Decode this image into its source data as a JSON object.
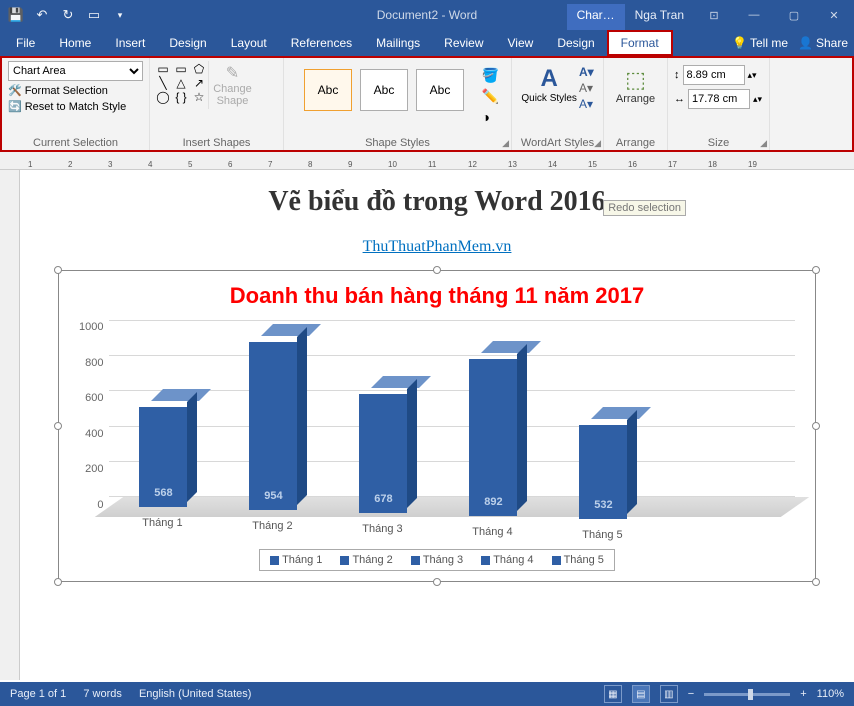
{
  "title": "Document2 - Word",
  "contextTab": "Char…",
  "user": "Nga Tran",
  "menu": [
    "File",
    "Home",
    "Insert",
    "Design",
    "Layout",
    "References",
    "Mailings",
    "Review",
    "View",
    "Design",
    "Format"
  ],
  "tellme": "Tell me",
  "share": "Share",
  "ribbon": {
    "selectionDropdown": "Chart Area",
    "formatSelection": "Format Selection",
    "resetMatch": "Reset to Match Style",
    "grpCurrent": "Current Selection",
    "changeShape": "Change Shape",
    "grpInsert": "Insert Shapes",
    "abc": "Abc",
    "grpStyles": "Shape Styles",
    "quickStyles": "Quick Styles",
    "grpWordArt": "WordArt Styles",
    "arrange": "Arrange",
    "grpArrange": "Arrange",
    "height": "8.89 cm",
    "width": "17.78 cm",
    "grpSize": "Size"
  },
  "tooltip": "Redo selection",
  "doc": {
    "heading": "Vẽ biểu đồ trong Word 2016",
    "link": "ThuThuatPhanMem.vn"
  },
  "chart_data": {
    "type": "bar",
    "title": "Doanh thu bán hàng tháng 11 năm 2017",
    "categories": [
      "Tháng 1",
      "Tháng 2",
      "Tháng 3",
      "Tháng 4",
      "Tháng 5"
    ],
    "values": [
      568,
      954,
      678,
      892,
      532
    ],
    "ylim": [
      0,
      1000
    ],
    "yticks": [
      0,
      200,
      400,
      600,
      800,
      1000
    ],
    "legend": [
      "Tháng 1",
      "Tháng 2",
      "Tháng 3",
      "Tháng 4",
      "Tháng 5"
    ]
  },
  "status": {
    "page": "Page 1 of 1",
    "words": "7 words",
    "lang": "English (United States)",
    "zoom": "110%"
  }
}
